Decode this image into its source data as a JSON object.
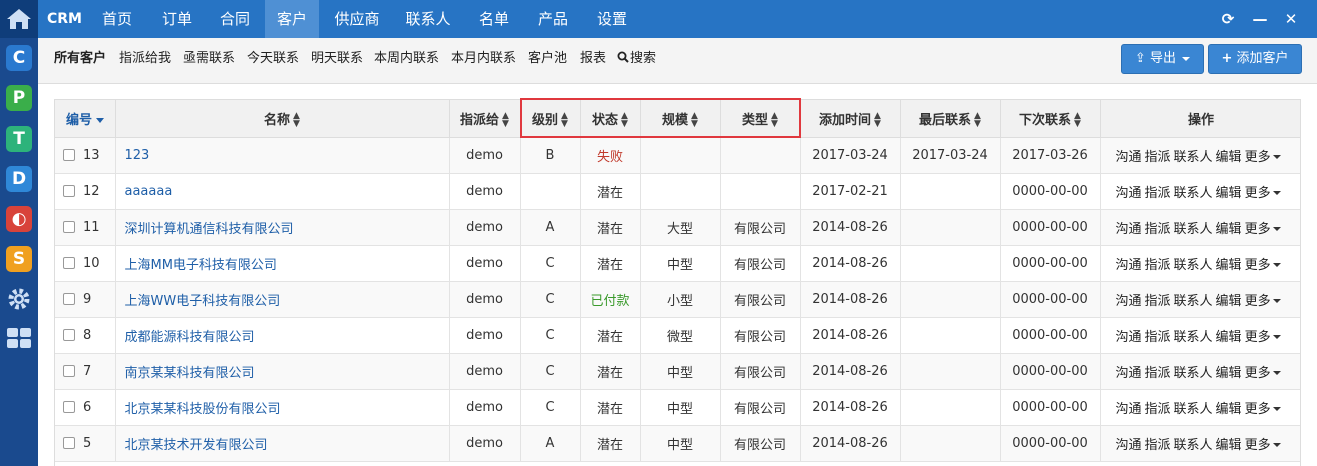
{
  "nav": {
    "brand": "CRM",
    "items": [
      "首页",
      "订单",
      "合同",
      "客户",
      "供应商",
      "联系人",
      "名单",
      "产品",
      "设置"
    ],
    "active_index": 3
  },
  "window_controls": {
    "refresh": "⟳",
    "minimize": "—",
    "close": "✕"
  },
  "rail_apps": [
    {
      "letter": "C",
      "color": "#2a79cf"
    },
    {
      "letter": "P",
      "color": "#3aae4a"
    },
    {
      "letter": "T",
      "color": "#2db37b"
    },
    {
      "letter": "D",
      "color": "#2f88d8"
    },
    {
      "letter": "◐",
      "color": "#d8433a"
    },
    {
      "letter": "S",
      "color": "#f0a020"
    }
  ],
  "subnav": {
    "links": [
      "所有客户",
      "指派给我",
      "亟需联系",
      "今天联系",
      "明天联系",
      "本周内联系",
      "本月内联系",
      "客户池",
      "报表",
      "搜索"
    ],
    "export_label": "导出",
    "add_label": "添加客户"
  },
  "table": {
    "headers": {
      "id": "编号",
      "name": "名称",
      "assigned": "指派给",
      "level": "级别",
      "status": "状态",
      "scale": "规模",
      "type": "类型",
      "created": "添加时间",
      "last_contact": "最后联系",
      "next_contact": "下次联系",
      "actions": "操作"
    },
    "action_labels": [
      "沟通",
      "指派",
      "联系人",
      "编辑",
      "更多"
    ],
    "rows": [
      {
        "id": "13",
        "name": "123",
        "assigned": "demo",
        "level": "B",
        "status": "失败",
        "status_color": "#c0392b",
        "scale": "",
        "type": "",
        "created": "2017-03-24",
        "last": "2017-03-24",
        "next": "2017-03-26"
      },
      {
        "id": "12",
        "name": "aaaaaa",
        "assigned": "demo",
        "level": "",
        "status": "潜在",
        "status_color": "#333333",
        "scale": "",
        "type": "",
        "created": "2017-02-21",
        "last": "",
        "next": "0000-00-00"
      },
      {
        "id": "11",
        "name": "深圳计算机通信科技有限公司",
        "assigned": "demo",
        "level": "A",
        "status": "潜在",
        "status_color": "#333333",
        "scale": "大型",
        "type": "有限公司",
        "created": "2014-08-26",
        "last": "",
        "next": "0000-00-00"
      },
      {
        "id": "10",
        "name": "上海MM电子科技有限公司",
        "assigned": "demo",
        "level": "C",
        "status": "潜在",
        "status_color": "#333333",
        "scale": "中型",
        "type": "有限公司",
        "created": "2014-08-26",
        "last": "",
        "next": "0000-00-00"
      },
      {
        "id": "9",
        "name": "上海WW电子科技有限公司",
        "assigned": "demo",
        "level": "C",
        "status": "已付款",
        "status_color": "#3a9a2c",
        "scale": "小型",
        "type": "有限公司",
        "created": "2014-08-26",
        "last": "",
        "next": "0000-00-00"
      },
      {
        "id": "8",
        "name": "成都能源科技有限公司",
        "assigned": "demo",
        "level": "C",
        "status": "潜在",
        "status_color": "#333333",
        "scale": "微型",
        "type": "有限公司",
        "created": "2014-08-26",
        "last": "",
        "next": "0000-00-00"
      },
      {
        "id": "7",
        "name": "南京某某科技有限公司",
        "assigned": "demo",
        "level": "C",
        "status": "潜在",
        "status_color": "#333333",
        "scale": "中型",
        "type": "有限公司",
        "created": "2014-08-26",
        "last": "",
        "next": "0000-00-00"
      },
      {
        "id": "6",
        "name": "北京某某科技股份有限公司",
        "assigned": "demo",
        "level": "C",
        "status": "潜在",
        "status_color": "#333333",
        "scale": "中型",
        "type": "有限公司",
        "created": "2014-08-26",
        "last": "",
        "next": "0000-00-00"
      },
      {
        "id": "5",
        "name": "北京某技术开发有限公司",
        "assigned": "demo",
        "level": "A",
        "status": "潜在",
        "status_color": "#333333",
        "scale": "中型",
        "type": "有限公司",
        "created": "2014-08-26",
        "last": "",
        "next": "0000-00-00"
      }
    ]
  }
}
